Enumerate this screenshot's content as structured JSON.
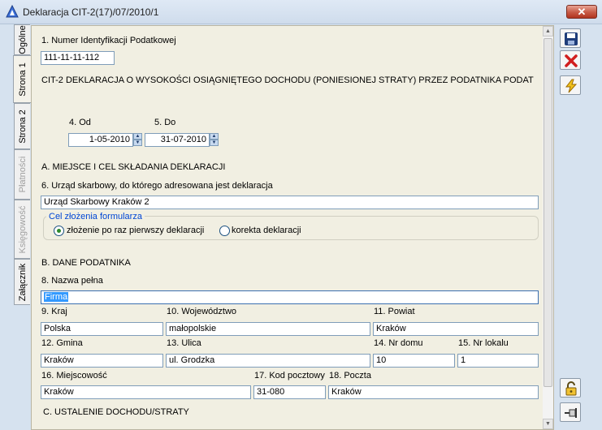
{
  "window": {
    "title": "Deklaracja CIT-2(17)/07/2010/1",
    "close_label": "✕"
  },
  "tabs": [
    {
      "label": "Ogólne",
      "state": "normal"
    },
    {
      "label": "Strona 1",
      "state": "active"
    },
    {
      "label": "Strona 2",
      "state": "normal"
    },
    {
      "label": "Płatności",
      "state": "disabled"
    },
    {
      "label": "Księgowość",
      "state": "disabled"
    },
    {
      "label": "Załącznik",
      "state": "normal"
    }
  ],
  "form": {
    "nip_label": "1. Numer Identyfikacji Podatkowej",
    "nip_value": "111-11-11-112",
    "declaration_title": "CIT-2  DEKLARACJA O WYSOKOŚCI OSIĄGNIĘTEGO DOCHODU (PONIESIONEJ STRATY) PRZEZ PODATNIKA PODAT",
    "from_label": "4. Od",
    "from_value": "1-05-2010",
    "to_label": "5. Do",
    "to_value": "31-07-2010",
    "section_a": "A. MIEJSCE I CEL SKŁADANIA DEKLARACJI",
    "office_label": "6. Urząd skarbowy, do którego adresowana jest deklaracja",
    "office_value": "Urząd Skarbowy Kraków 2",
    "purpose_group": "Cel złożenia formularza",
    "purpose_first": "złożenie po raz pierwszy deklaracji",
    "purpose_correction": "korekta deklaracji",
    "section_b": "B. DANE PODATNIKA",
    "name_label": "8. Nazwa pełna",
    "name_value": "Firma",
    "country_label": "9. Kraj",
    "country_value": "Polska",
    "province_label": "10. Województwo",
    "province_value": "małopolskie",
    "county_label": "11. Powiat",
    "county_value": "Kraków",
    "commune_label": "12. Gmina",
    "commune_value": "Kraków",
    "street_label": "13. Ulica",
    "street_value": "ul. Grodzka",
    "house_label": "14. Nr domu",
    "house_value": "10",
    "flat_label": "15. Nr lokalu",
    "flat_value": "1",
    "city_label": "16. Miejscowość",
    "city_value": "Kraków",
    "postcode_label": "17. Kod pocztowy",
    "postcode_value": "31-080",
    "post_label": "18. Poczta",
    "post_value": "Kraków",
    "section_c": "C. USTALENIE DOCHODU/STRATY"
  },
  "toolbar": {
    "icons": [
      "save-icon",
      "cancel-icon",
      "lightning-icon",
      "unlock-icon",
      "pin-icon"
    ]
  },
  "colors": {
    "panel_bg": "#f1efe2",
    "frame_bg": "#d6e2ef",
    "selection": "#3399ff",
    "group_legend": "#0046d5"
  }
}
